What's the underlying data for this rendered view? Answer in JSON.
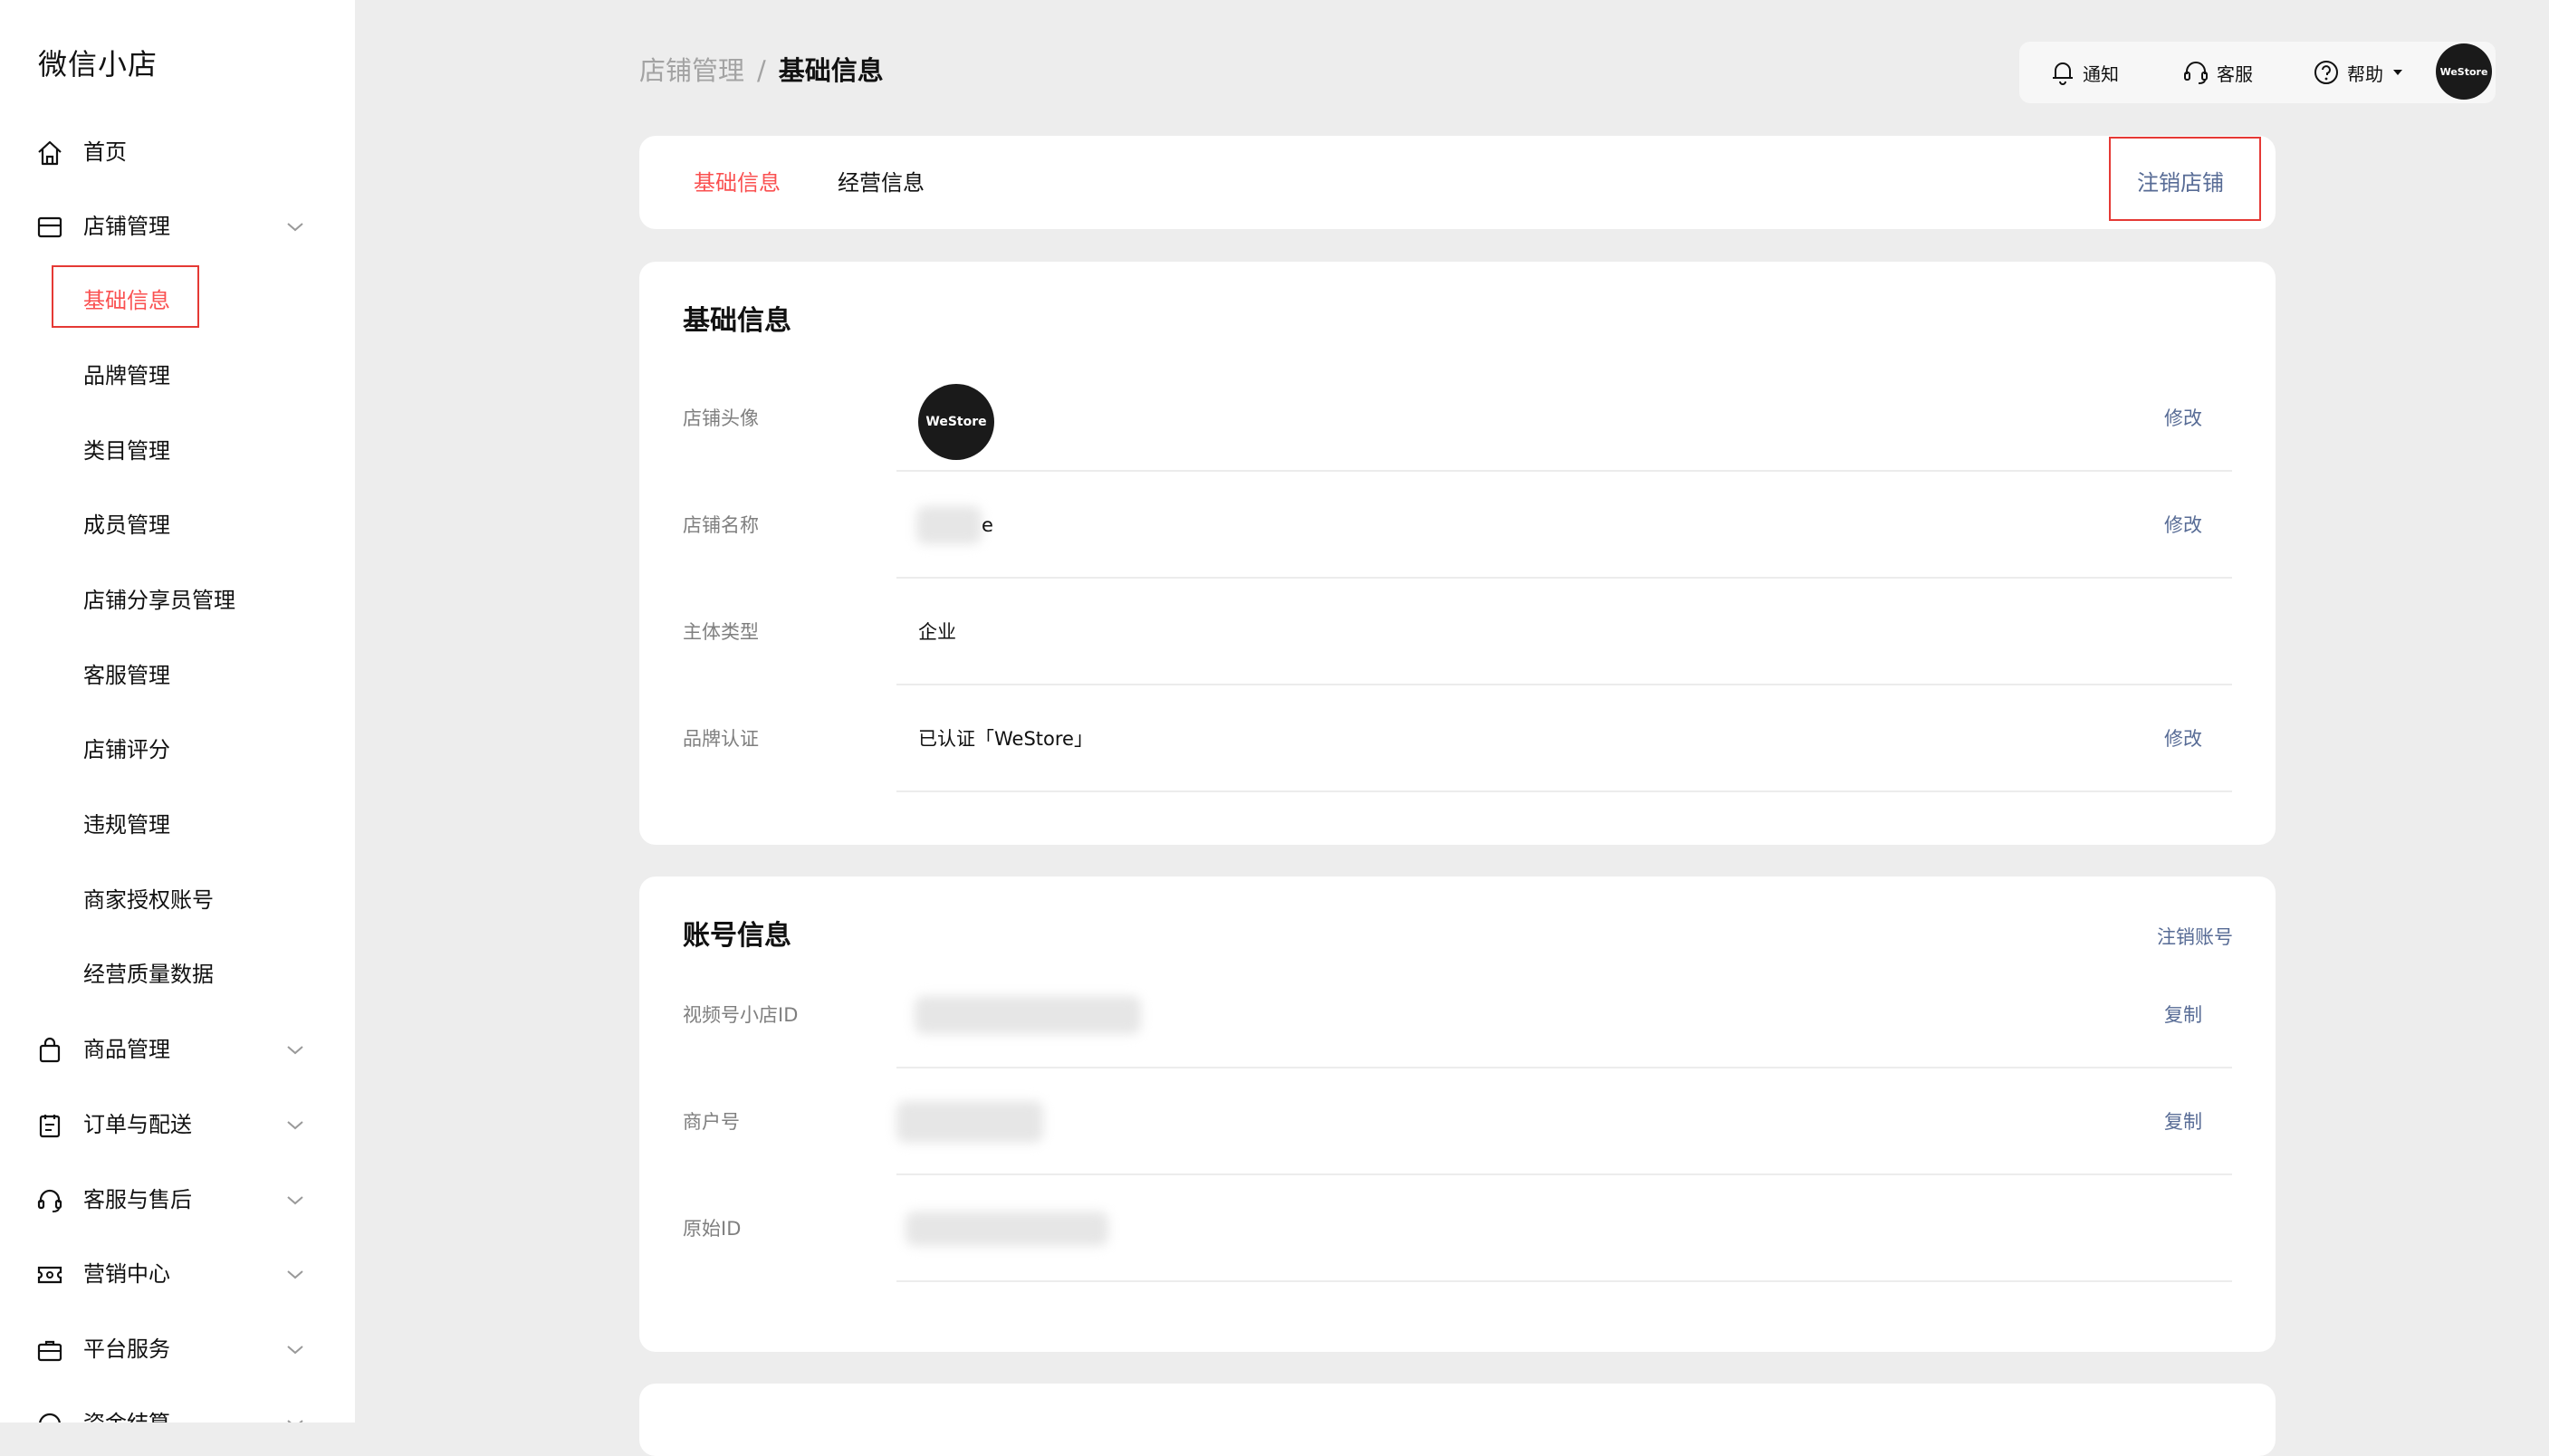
{
  "app": {
    "title": "微信小店"
  },
  "sidebar": {
    "items": [
      {
        "label": "首页",
        "icon": "home-icon"
      },
      {
        "label": "店铺管理",
        "icon": "store-icon",
        "expanded": true
      },
      {
        "label": "商品管理",
        "icon": "shopping-bag-icon"
      },
      {
        "label": "订单与配送",
        "icon": "clipboard-icon"
      },
      {
        "label": "客服与售后",
        "icon": "headset-icon"
      },
      {
        "label": "营销中心",
        "icon": "ticket-icon"
      },
      {
        "label": "平台服务",
        "icon": "briefcase-icon"
      },
      {
        "label": "资金结算",
        "icon": "money-icon"
      }
    ],
    "store_sub_items": [
      {
        "label": "基础信息",
        "active": true
      },
      {
        "label": "品牌管理"
      },
      {
        "label": "类目管理"
      },
      {
        "label": "成员管理"
      },
      {
        "label": "店铺分享员管理"
      },
      {
        "label": "客服管理"
      },
      {
        "label": "店铺评分"
      },
      {
        "label": "违规管理"
      },
      {
        "label": "商家授权账号"
      },
      {
        "label": "经营质量数据"
      }
    ]
  },
  "breadcrumb": {
    "parent": "店铺管理",
    "separator": "/",
    "current": "基础信息"
  },
  "topbar": {
    "notify": "通知",
    "service": "客服",
    "help": "帮助",
    "avatar_text": "WeStore"
  },
  "tabs": {
    "items": [
      {
        "label": "基础信息",
        "active": true
      },
      {
        "label": "经营信息",
        "active": false
      }
    ],
    "cancel_store": "注销店铺"
  },
  "basic_info": {
    "title": "基础信息",
    "rows": [
      {
        "label": "店铺头像",
        "value": "",
        "action": "修改",
        "avatar_text": "WeStore"
      },
      {
        "label": "店铺名称",
        "value": "e",
        "action": "修改"
      },
      {
        "label": "主体类型",
        "value": "企业",
        "action": ""
      },
      {
        "label": "品牌认证",
        "value": "已认证「WeStore」",
        "action": "修改"
      }
    ]
  },
  "account_info": {
    "title": "账号信息",
    "cancel_account": "注销账号",
    "rows": [
      {
        "label": "视频号小店ID",
        "action": "复制"
      },
      {
        "label": "商户号",
        "action": "复制"
      },
      {
        "label": "原始ID",
        "action": ""
      }
    ]
  },
  "colors": {
    "accent_red": "#fa5151",
    "link_blue": "#576b95",
    "highlight_box": "#e53935",
    "background": "#ededed"
  }
}
